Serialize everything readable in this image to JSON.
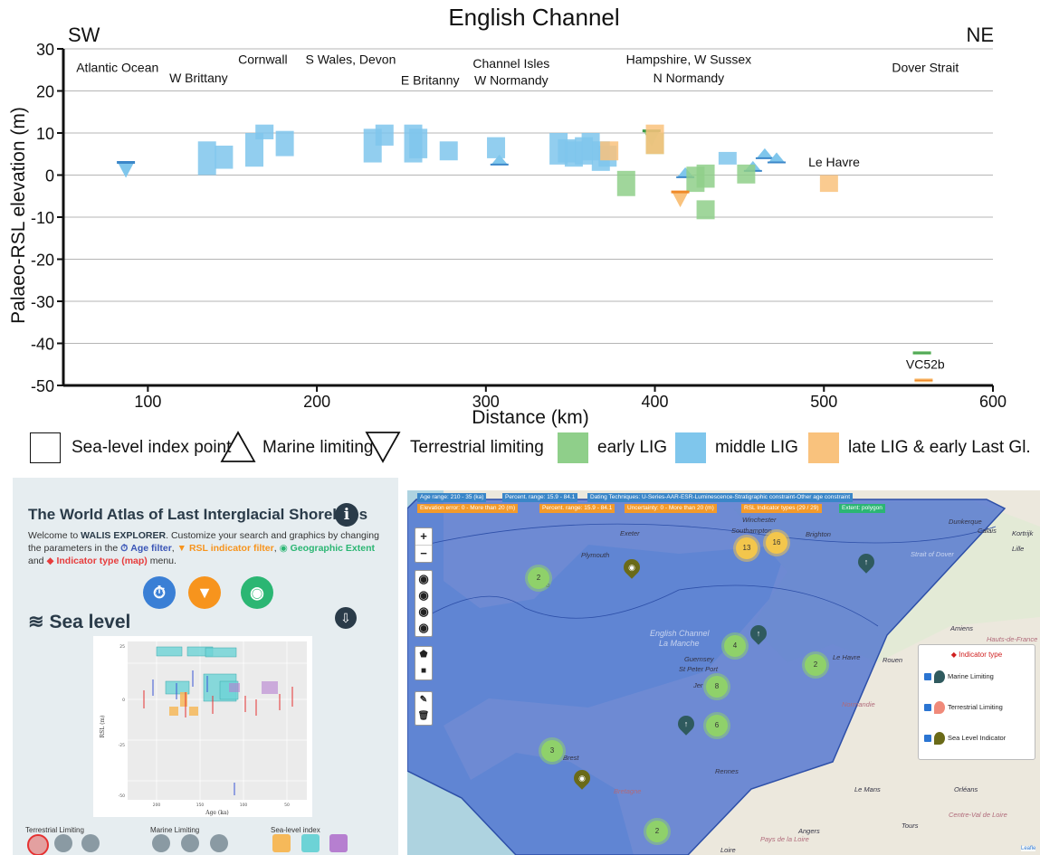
{
  "chart_data": {
    "type": "scatter",
    "title": "English Channel",
    "xlabel": "Distance (km)",
    "ylabel": "Palaeo-RSL elevation (m)",
    "xlim": [
      50,
      600
    ],
    "ylim": [
      -50,
      30
    ],
    "xticks": [
      "100",
      "200",
      "300",
      "400",
      "500",
      "600"
    ],
    "yticks": [
      "30",
      "20",
      "10",
      "0",
      "-10",
      "-20",
      "-30",
      "-40",
      "-50"
    ],
    "grid": "horizontal",
    "corner_labels": {
      "left": "SW",
      "right": "NE"
    },
    "regions": [
      {
        "text": "Atlantic Ocean",
        "x": 82,
        "y": 24.5
      },
      {
        "text": "W Brittany",
        "x": 130,
        "y": 22
      },
      {
        "text": "Cornwall",
        "x": 168,
        "y": 26.5
      },
      {
        "text": "S Wales, Devon",
        "x": 220,
        "y": 26.5
      },
      {
        "text": "E Britanny",
        "x": 267,
        "y": 21.5
      },
      {
        "text": "Channel Isles",
        "x": 315,
        "y": 25.5
      },
      {
        "text": "W Normandy",
        "x": 315,
        "y": 21.5
      },
      {
        "text": "Hampshire, W Sussex",
        "x": 420,
        "y": 26.5
      },
      {
        "text": "N Normandy",
        "x": 420,
        "y": 22
      },
      {
        "text": "Dover Strait",
        "x": 560,
        "y": 24.5
      },
      {
        "text": "Le Havre",
        "x": 506,
        "y": 2
      },
      {
        "text": "VC52b",
        "x": 560,
        "y": -46
      }
    ],
    "legend": [
      {
        "label": "Sea-level index point",
        "symbol": "box"
      },
      {
        "label": "Marine limiting",
        "symbol": "triangle-up"
      },
      {
        "label": "Terrestrial limiting",
        "symbol": "triangle-down"
      },
      {
        "label": "early LIG",
        "color": "#8fcf8a"
      },
      {
        "label": "middle LIG",
        "color": "#7fc6ec"
      },
      {
        "label": "late LIG & early Last Gl.",
        "color": "#f9c27d"
      }
    ],
    "series": [
      {
        "name": "middle LIG",
        "color": "#7fc6ec",
        "boxes": [
          {
            "x": 135,
            "ylo": 0,
            "yhi": 8
          },
          {
            "x": 145,
            "ylo": 1.5,
            "yhi": 7
          },
          {
            "x": 163,
            "ylo": 2,
            "yhi": 10
          },
          {
            "x": 169,
            "ylo": 8.5,
            "yhi": 12
          },
          {
            "x": 181,
            "ylo": 4.5,
            "yhi": 10.5
          },
          {
            "x": 233,
            "ylo": 3,
            "yhi": 11
          },
          {
            "x": 240,
            "ylo": 7,
            "yhi": 12
          },
          {
            "x": 257,
            "ylo": 3,
            "yhi": 12
          },
          {
            "x": 260,
            "ylo": 4,
            "yhi": 11
          },
          {
            "x": 278,
            "ylo": 3.5,
            "yhi": 8
          },
          {
            "x": 306,
            "ylo": 4,
            "yhi": 9
          },
          {
            "x": 343,
            "ylo": 2.5,
            "yhi": 10
          },
          {
            "x": 348,
            "ylo": 3,
            "yhi": 8.5
          },
          {
            "x": 352,
            "ylo": 2,
            "yhi": 8
          },
          {
            "x": 358,
            "ylo": 2.5,
            "yhi": 9
          },
          {
            "x": 362,
            "ylo": 3.5,
            "yhi": 10
          },
          {
            "x": 368,
            "ylo": 1,
            "yhi": 8
          },
          {
            "x": 372,
            "ylo": 2,
            "yhi": 7
          },
          {
            "x": 443,
            "ylo": 2.5,
            "yhi": 5.5
          }
        ],
        "marine": [
          {
            "x": 308,
            "y": 2.5
          },
          {
            "x": 418,
            "y": -0.5
          },
          {
            "x": 465,
            "y": 4
          },
          {
            "x": 472,
            "y": 3
          },
          {
            "x": 458,
            "y": 1
          }
        ],
        "terrestrial": [
          {
            "x": 87,
            "y": 3
          }
        ]
      },
      {
        "name": "early LIG",
        "color": "#8fcf8a",
        "boxes": [
          {
            "x": 400,
            "ylo": 5,
            "yhi": 10
          },
          {
            "x": 383,
            "ylo": -5,
            "yhi": 1
          },
          {
            "x": 424,
            "ylo": -4,
            "yhi": 2
          },
          {
            "x": 430,
            "ylo": -10.5,
            "yhi": -6
          },
          {
            "x": 454,
            "ylo": -2,
            "yhi": 2.5
          },
          {
            "x": 430,
            "ylo": -3,
            "yhi": 2.5
          }
        ],
        "terrestrial": [
          {
            "x": 398,
            "y": 10.5
          }
        ],
        "index_points": [
          {
            "x": 558,
            "y": -42.5
          }
        ]
      },
      {
        "name": "late LIG & early Last Gl.",
        "color": "#f9c27d",
        "boxes": [
          {
            "x": 400,
            "ylo": 5,
            "yhi": 12
          },
          {
            "x": 373,
            "ylo": 3.5,
            "yhi": 8
          },
          {
            "x": 503,
            "ylo": -4,
            "yhi": 0
          }
        ],
        "terrestrial": [
          {
            "x": 415,
            "y": -4
          }
        ],
        "index_points": [
          {
            "x": 559,
            "y": -49
          }
        ]
      }
    ]
  },
  "walis": {
    "title": "The World Atlas of Last Interglacial Shorelines",
    "info_icon": "info-icon",
    "welcome_1": "Welcome to",
    "brand": "WALIS EXPLORER",
    "welcome_2": ". Customize your search and graphics by changing the parameters in the",
    "age_filter": "Age filter",
    "rsl_filter": "RSL indicator filter",
    "geo_extent": "Geographic Extent",
    "and": "and",
    "indicator_type": "Indicator type (map)",
    "menu": "menu.",
    "section": "Sea level",
    "mini_ylabel": "RSL (m)",
    "mini_xlabel": "Age (ka)",
    "mini_xticks": [
      "200",
      "150",
      "100",
      "50"
    ],
    "mini_yticks": [
      "25",
      "0",
      "-25",
      "-50"
    ],
    "groups": [
      "Terrestrial Limiting",
      "Marine Limiting",
      "Sea-level index"
    ],
    "colors": {
      "age": "#3a7fd5",
      "rsl": "#f7941d",
      "geo": "#2bb673",
      "ind": "#e73c3c"
    }
  },
  "map": {
    "chips_row1": [
      "Age range: 210 - 35 (ka)",
      "Percent. range: 15.9 - 84.1",
      "Dating Techniques: U-Series-AAR-ESR-Luminescence-Stratigraphic constraint-Other age constraint"
    ],
    "chips_row2": [
      "Elevation error: 0 - More than 20 (m)",
      "Percent. range: 15.9 - 84.1",
      "Uncertainty: 0 - More than 20 (m)",
      "RSL Indicator types (29 / 29)",
      "Extent: polygon"
    ],
    "zoom_in": "+",
    "zoom_out": "−",
    "place_labels": [
      "Winchester",
      "Southampton",
      "Brighton",
      "Exeter",
      "Plymouth",
      "Truro",
      "English Channel",
      "La Manche",
      "Guernsey",
      "St Peter Port",
      "Jer",
      "Le Havre",
      "Rouen",
      "Amiens",
      "Lille",
      "Calais",
      "Dunkerque",
      "Kortrijk",
      "Brest",
      "Rennes",
      "Le Mans",
      "Orléans",
      "Tours",
      "Angers",
      "Pays de la Loire",
      "Centre-Val de Loire",
      "Bretagne",
      "Normandie",
      "Hauts-de-France",
      "Strait of Dover",
      "Loire"
    ],
    "clusters": [
      {
        "n": "2",
        "color": "#8fd16a"
      },
      {
        "n": "13",
        "color": "#f3c64c"
      },
      {
        "n": "16",
        "color": "#f3c64c"
      },
      {
        "n": "4",
        "color": "#8fd16a"
      },
      {
        "n": "2",
        "color": "#8fd16a"
      },
      {
        "n": "8",
        "color": "#8fd16a"
      },
      {
        "n": "6",
        "color": "#8fd16a"
      },
      {
        "n": "3",
        "color": "#8fd16a"
      },
      {
        "n": "2",
        "color": "#8fd16a"
      }
    ],
    "legend_title": "Indicator type",
    "legend_items": [
      "Marine Limiting",
      "Terrestrial Limiting",
      "Sea Level Indicator"
    ],
    "attribution": "Leafle"
  }
}
